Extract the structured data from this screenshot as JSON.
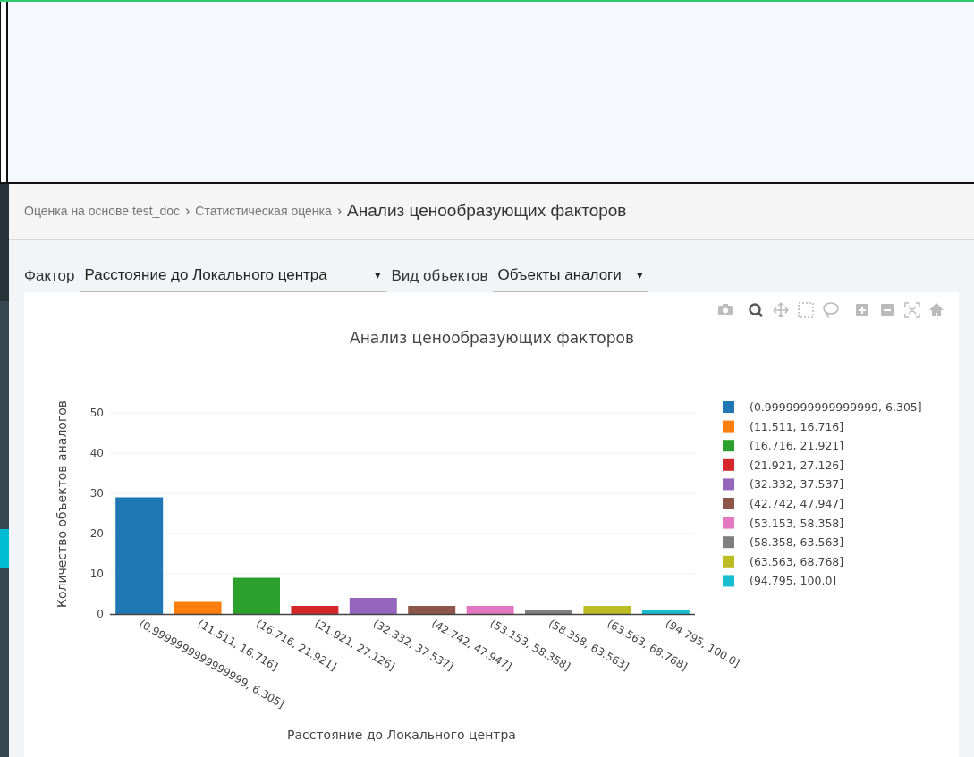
{
  "sidebar": {
    "items": [
      {
        "selected": false
      },
      {
        "selected": false
      },
      {
        "selected": false
      },
      {
        "selected": false
      },
      {
        "selected": false
      },
      {
        "selected": false
      },
      {
        "selected": true
      },
      {
        "selected": false
      },
      {
        "selected": false
      },
      {
        "selected": false
      },
      {
        "selected": false
      },
      {
        "selected": false
      }
    ]
  },
  "breadcrumb": {
    "items": [
      {
        "label": "Оценка на основе test_doc",
        "current": false
      },
      {
        "label": "Статистическая оценка",
        "current": false
      },
      {
        "label": "Анализ ценообразующих факторов",
        "current": true
      }
    ],
    "separators": [
      "›",
      "›"
    ]
  },
  "filters": [
    {
      "label": "Фактор",
      "value": "Расстояние до Локального центра",
      "caret": "▾"
    },
    {
      "label": "Вид объектов",
      "value": "Объекты аналоги",
      "caret": "▾"
    }
  ],
  "modebar": [
    {
      "kind": "camera",
      "active": false
    },
    {
      "kind": "zoom",
      "active": true
    },
    {
      "kind": "pan",
      "active": false
    },
    {
      "kind": "box-select",
      "active": false
    },
    {
      "kind": "lasso",
      "active": false
    },
    {
      "kind": "zoom-in",
      "active": false
    },
    {
      "kind": "zoom-out",
      "active": false
    },
    {
      "kind": "autoscale",
      "active": false
    },
    {
      "kind": "home",
      "active": false
    }
  ],
  "chart": {
    "chart_data": {
      "type": "bar",
      "title": "Анализ ценообразующих факторов",
      "xlabel": "Расстояние до Локального центра",
      "ylabel": "Количество объектов аналогов",
      "categories": [
        "(0.9999999999999999, 6.305]",
        "(11.511, 16.716]",
        "(16.716, 21.921]",
        "(21.921, 27.126]",
        "(32.332, 37.537]",
        "(42.742, 47.947]",
        "(53.153, 58.358]",
        "(58.358, 63.563]",
        "(63.563, 68.768]",
        "(94.795, 100.0]"
      ],
      "ylim": [
        0,
        50
      ],
      "yticks": [
        0,
        10,
        20,
        30,
        40,
        50
      ],
      "grid": true,
      "legend": "right",
      "series": [
        {
          "name": "(0.9999999999999999, 6.305]",
          "color": "#1f77b4",
          "values": [
            29,
            null,
            null,
            null,
            null,
            null,
            null,
            null,
            null,
            null
          ]
        },
        {
          "name": "(11.511, 16.716]",
          "color": "#ff7f0e",
          "values": [
            null,
            3,
            null,
            null,
            null,
            null,
            null,
            null,
            null,
            null
          ]
        },
        {
          "name": "(16.716, 21.921]",
          "color": "#2ca02c",
          "values": [
            null,
            null,
            9,
            null,
            null,
            null,
            null,
            null,
            null,
            null
          ]
        },
        {
          "name": "(21.921, 27.126]",
          "color": "#d62728",
          "values": [
            null,
            null,
            null,
            2,
            null,
            null,
            null,
            null,
            null,
            null
          ]
        },
        {
          "name": "(32.332, 37.537]",
          "color": "#9467bd",
          "values": [
            null,
            null,
            null,
            null,
            4,
            null,
            null,
            null,
            null,
            null
          ]
        },
        {
          "name": "(42.742, 47.947]",
          "color": "#8c564b",
          "values": [
            null,
            null,
            null,
            null,
            null,
            2,
            null,
            null,
            null,
            null
          ]
        },
        {
          "name": "(53.153, 58.358]",
          "color": "#e377c2",
          "values": [
            null,
            null,
            null,
            null,
            null,
            null,
            2,
            null,
            null,
            null
          ]
        },
        {
          "name": "(58.358, 63.563]",
          "color": "#7f7f7f",
          "values": [
            null,
            null,
            null,
            null,
            null,
            null,
            null,
            1,
            null,
            null
          ]
        },
        {
          "name": "(63.563, 68.768]",
          "color": "#bcbd22",
          "values": [
            null,
            null,
            null,
            null,
            null,
            null,
            null,
            null,
            2,
            null
          ]
        },
        {
          "name": "(94.795, 100.0]",
          "color": "#17becf",
          "values": [
            null,
            null,
            null,
            null,
            null,
            null,
            null,
            null,
            null,
            1
          ]
        }
      ]
    }
  }
}
